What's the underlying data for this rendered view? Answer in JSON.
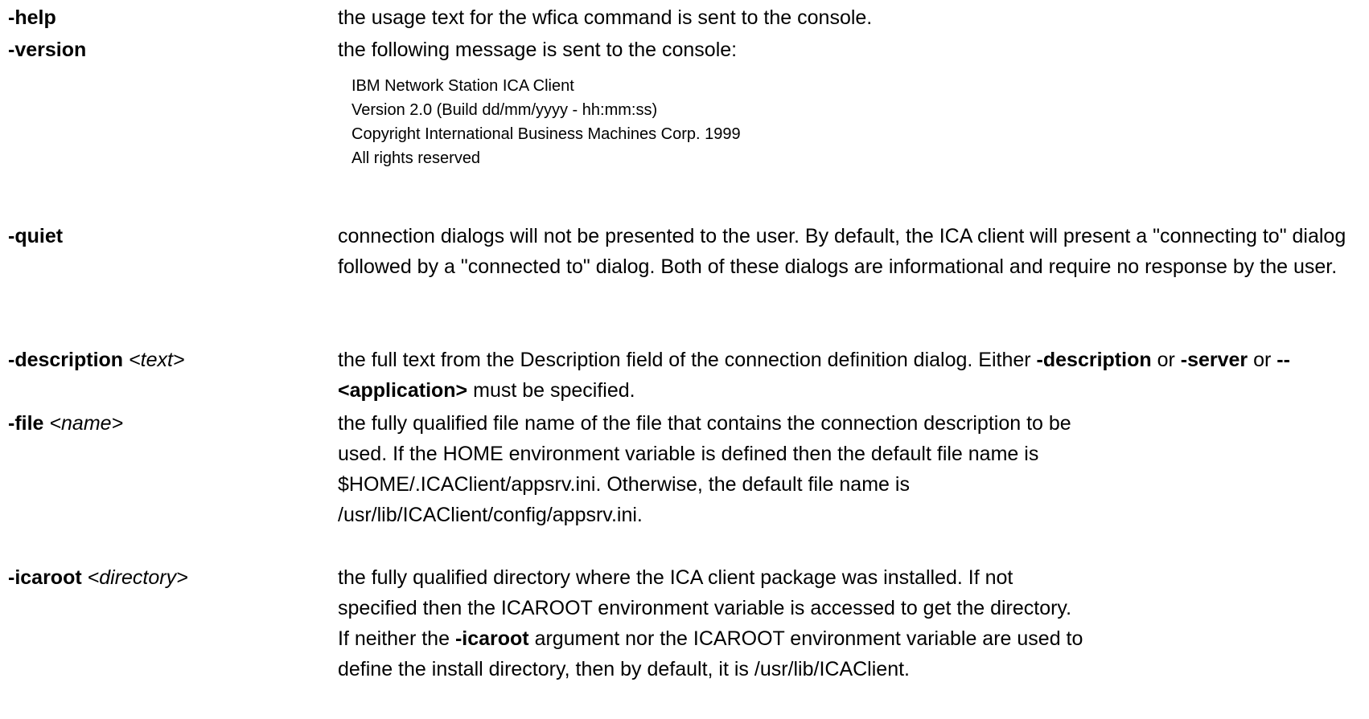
{
  "options": {
    "help": {
      "flag": "-help",
      "description": "the usage text for the wfica command is sent to the console."
    },
    "version": {
      "flag": "-version",
      "description": "the following message is sent to the console:",
      "console_message": [
        "IBM Network Station ICA Client",
        "Version 2.0  (Build dd/mm/yyyy - hh:mm:ss)",
        "Copyright International Business Machines Corp. 1999",
        "All rights reserved"
      ]
    },
    "quiet": {
      "flag": "-quiet",
      "description": "connection dialogs will not be presented to the user. By default, the ICA client will present a \"connecting to\" dialog followed by a \"connected to\" dialog. Both of these dialogs are informational and require no response by the user."
    },
    "description": {
      "flag": "-description",
      "arg": "<text>",
      "desc_part1": "the full text from the Description field of the connection definition dialog. Either ",
      "desc_bold1": "-description",
      "desc_part2": " or ",
      "desc_bold2": "-server",
      "desc_part3": " or ",
      "desc_bold3": "-- <application>",
      "desc_part4": " must be specified."
    },
    "file": {
      "flag": "-file",
      "arg": "<name>",
      "line1": "the fully qualified file name of the file that contains the connection description to be",
      "line2": "used. If the HOME environment variable is defined then the default file name is",
      "line3": "$HOME/.ICAClient/appsrv.ini. Otherwise, the default file name is",
      "line4": "/usr/lib/ICAClient/config/appsrv.ini."
    },
    "icaroot": {
      "flag": "-icaroot",
      "arg": "<directory>",
      "line1": "the fully qualified directory where the ICA client package was installed. If not",
      "line2": "specified then the ICAROOT environment variable is accessed to get the directory.",
      "line3_part1": "If neither the ",
      "line3_bold": "-icaroot",
      "line3_part2": " argument nor the ICAROOT environment variable are used to",
      "line4": "define the install directory, then by default, it is /usr/lib/ICAClient."
    }
  }
}
